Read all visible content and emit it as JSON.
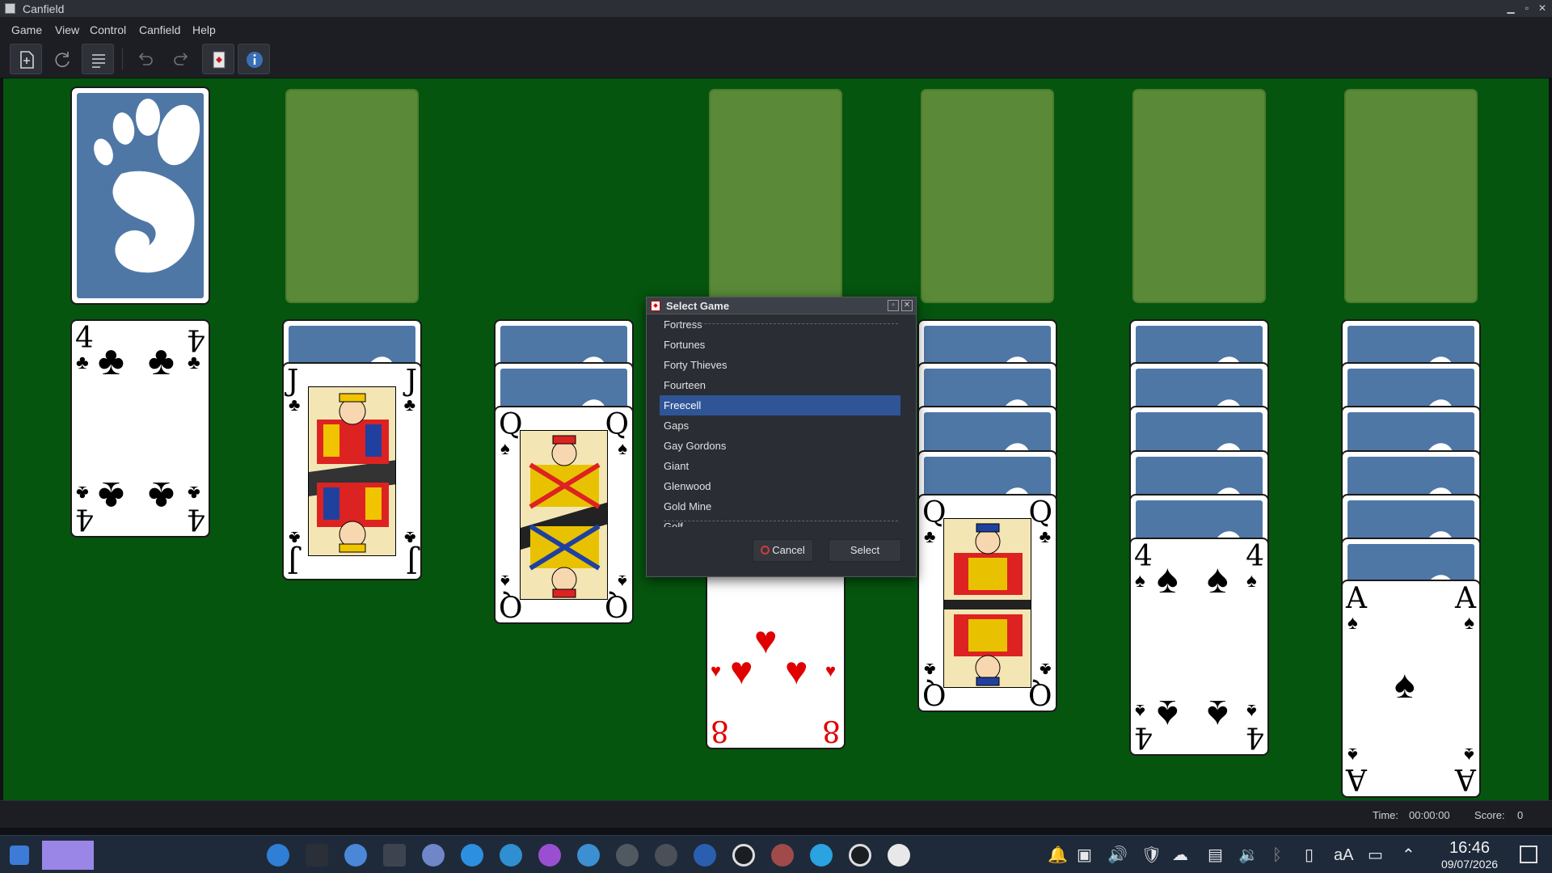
{
  "window": {
    "title": "Canfield"
  },
  "menu": {
    "items": [
      "Game",
      "View",
      "Control",
      "Canfield",
      "Help"
    ]
  },
  "toolbar": {
    "buttons": [
      "new-game-icon",
      "restart-icon",
      "select-game-icon",
      "undo-icon",
      "redo-icon",
      "hint-icon",
      "info-icon"
    ]
  },
  "cards": {
    "reserve_top": {
      "rank": "4",
      "suit": "♣",
      "color": "#000000"
    },
    "tableau_1": {
      "rank": "J",
      "suit": "♣"
    },
    "tableau_2": {
      "rank": "Q",
      "suit": "♠"
    },
    "tableau_3": {
      "rank": "8",
      "suit": "♥",
      "color": "#e00000"
    },
    "tableau_4": {
      "rank": "Q",
      "suit": "♣"
    },
    "tableau_5": {
      "rank": "4",
      "suit": "♠"
    },
    "tableau_6": {
      "rank": "A",
      "suit": "♠"
    }
  },
  "dialog": {
    "title": "Select Game",
    "games": [
      "Fortress",
      "Fortunes",
      "Forty Thieves",
      "Fourteen",
      "Freecell",
      "Gaps",
      "Gay Gordons",
      "Giant",
      "Glenwood",
      "Gold Mine",
      "Golf"
    ],
    "selected": "Freecell",
    "cancel_label": "Cancel",
    "select_label": "Select"
  },
  "status": {
    "time_label": "Time:",
    "time_value": "00:00:00",
    "score_label": "Score:",
    "score_value": "0"
  },
  "taskbar": {
    "time": "16:46",
    "date": "09/07/2026"
  },
  "colors": {
    "table": "#05550e",
    "slot": "#5a8a38",
    "card_back": "#4f77a5",
    "selection": "#2f5597"
  }
}
